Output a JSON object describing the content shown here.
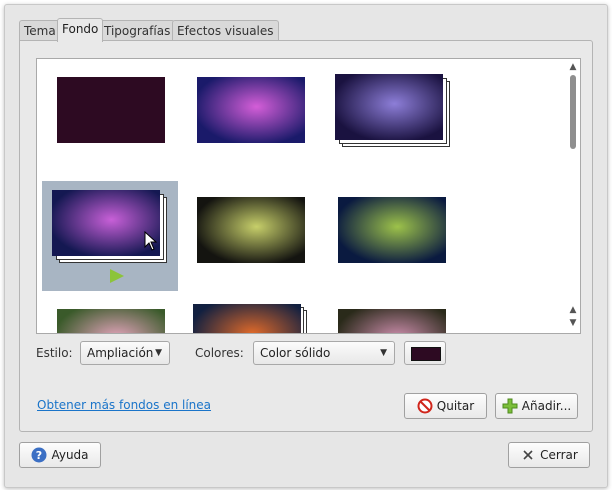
{
  "tabs": [
    {
      "label": "Tema"
    },
    {
      "label": "Fondo",
      "active": true
    },
    {
      "label": "Tipografías"
    },
    {
      "label": "Efectos visuales"
    }
  ],
  "gallery": {
    "scroll_position": 0.12,
    "selected_index": 3,
    "items": [
      {
        "name": "solid-color",
        "colors": [
          "#2d0a22",
          "#2d0a22"
        ]
      },
      {
        "name": "purple-aurora",
        "colors": [
          "#d45ed8",
          "#1a1a6a"
        ]
      },
      {
        "name": "purple-nebula",
        "colors": [
          "#8d7ed8",
          "#1a1240"
        ],
        "stacked": true
      },
      {
        "name": "purple-nebula-slideshow",
        "colors": [
          "#c860d8",
          "#141852"
        ],
        "stacked": true,
        "selected": true
      },
      {
        "name": "tree-branches",
        "colors": [
          "#c7cf6a",
          "#141410"
        ]
      },
      {
        "name": "green-light-rays",
        "colors": [
          "#9dc24a",
          "#0a1a40"
        ]
      },
      {
        "name": "pink-flowers",
        "colors": [
          "#e8a6c0",
          "#3a5a2a"
        ]
      },
      {
        "name": "colorful-nebula",
        "colors": [
          "#e06a2a",
          "#122040"
        ],
        "stacked": true
      },
      {
        "name": "dark-flowers",
        "colors": [
          "#d090b0",
          "#2a2a1a"
        ]
      }
    ]
  },
  "style": {
    "label": "Estilo:",
    "value": "Ampliación"
  },
  "colors": {
    "label": "Colores:",
    "value": "Color sólido",
    "swatch": "#2d0a22"
  },
  "more_link": "Obtener más fondos en línea",
  "buttons": {
    "remove": "Quitar",
    "add": "Añadir...",
    "help": "Ayuda",
    "close": "Cerrar"
  }
}
